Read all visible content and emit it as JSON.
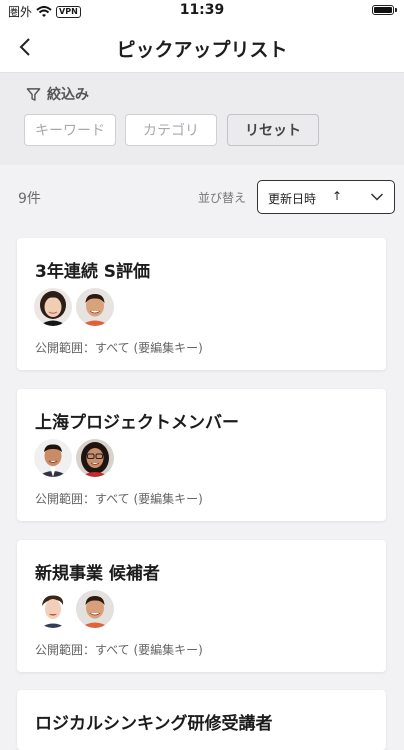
{
  "status_bar": {
    "carrier": "圏外",
    "vpn": "VPN",
    "time": "11:39"
  },
  "nav": {
    "title": "ピックアップリスト"
  },
  "filter": {
    "heading": "絞込み",
    "keyword_placeholder": "キーワード",
    "category_placeholder": "カテゴリ",
    "reset_label": "リセット"
  },
  "list_header": {
    "count": "9件",
    "sort_label": "並び替え",
    "sort_value": "更新日時",
    "sort_direction": "↑"
  },
  "cards": [
    {
      "title": "3年連続 S評価",
      "meta": "公開範囲：すべて (要編集キー)",
      "avatars": [
        "woman-bob-avatar",
        "man-short-hair-avatar"
      ]
    },
    {
      "title": "上海プロジェクトメンバー",
      "meta": "公開範囲：すべて (要編集キー)",
      "avatars": [
        "man-suit-avatar",
        "woman-glasses-avatar"
      ]
    },
    {
      "title": "新規事業 候補者",
      "meta": "公開範囲：すべて (要編集キー)",
      "avatars": [
        "woman-tied-hair-avatar",
        "man-smiling-avatar"
      ]
    },
    {
      "title": "ロジカルシンキング研修受講者"
    }
  ]
}
